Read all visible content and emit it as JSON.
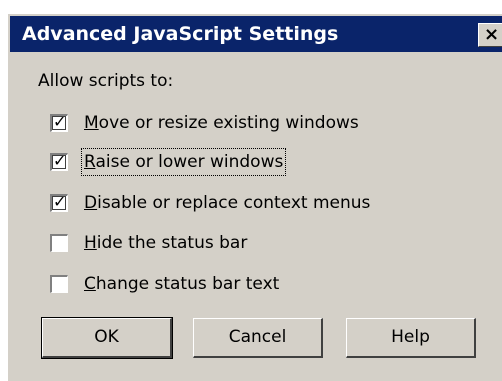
{
  "dialog": {
    "title": "Advanced JavaScript Settings",
    "close_glyph": "×",
    "allow_label": "Allow scripts to:",
    "options": [
      {
        "accel": "M",
        "rest": "ove or resize existing windows",
        "checked": true
      },
      {
        "accel": "R",
        "rest": "aise or lower windows",
        "checked": true
      },
      {
        "accel": "D",
        "rest": "isable or replace context menus",
        "checked": true
      },
      {
        "accel": "H",
        "rest": "ide the status bar",
        "checked": false
      },
      {
        "accel": "C",
        "rest": "hange status bar text",
        "checked": false
      }
    ],
    "checkmark_glyph": "✓",
    "buttons": {
      "ok": "OK",
      "cancel": "Cancel",
      "help": "Help"
    }
  },
  "colors": {
    "titlebar": "#0a246a",
    "dialog_face": "#d4d0c8"
  },
  "icons": {
    "close": "close-icon",
    "check": "checkmark-icon"
  }
}
